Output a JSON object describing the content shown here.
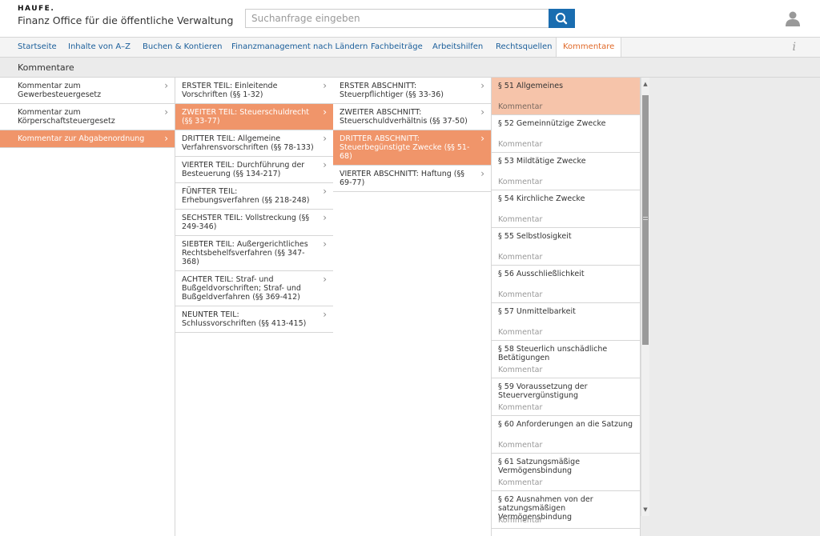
{
  "header": {
    "logo": "HAUFE.",
    "app_title": "Finanz Office für die öffentliche Verwaltung",
    "search_placeholder": "Suchanfrage eingeben"
  },
  "nav": {
    "items": [
      "Startseite",
      "Inhalte von A–Z",
      "Buchen & Kontieren",
      "Finanzmanagement nach Ländern",
      "Fachbeiträge",
      "Arbeitshilfen",
      "Rechtsquellen",
      "Kommentare"
    ],
    "active_index": 7,
    "info": "i"
  },
  "page_title": "Kommentare",
  "col1": [
    {
      "label": "Kommentar zum Gewerbesteuergesetz",
      "active": false
    },
    {
      "label": "Kommentar zum Körperschaftsteuergesetz",
      "active": false
    },
    {
      "label": "Kommentar zur Abgabenordnung",
      "active": true
    }
  ],
  "col2": [
    {
      "label": "ERSTER TEIL: Einleitende Vorschriften (§§ 1-32)",
      "active": false
    },
    {
      "label": "ZWEITER TEIL: Steuerschuldrecht (§§ 33-77)",
      "active": true
    },
    {
      "label": "DRITTER TEIL: Allgemeine Verfahrensvorschriften (§§ 78-133)",
      "active": false
    },
    {
      "label": "VIERTER TEIL: Durchführung der Besteuerung (§§ 134-217)",
      "active": false
    },
    {
      "label": "FÜNFTER TEIL: Erhebungsverfahren (§§ 218-248)",
      "active": false
    },
    {
      "label": "SECHSTER TEIL: Vollstreckung (§§ 249-346)",
      "active": false
    },
    {
      "label": "SIEBTER TEIL: Außergerichtliches Rechtsbehelfsverfahren (§§ 347-368)",
      "active": false
    },
    {
      "label": "ACHTER TEIL: Straf- und Bußgeldvorschriften; Straf- und Bußgeldverfahren (§§ 369-412)",
      "active": false
    },
    {
      "label": "NEUNTER TEIL: Schlussvorschriften (§§ 413-415)",
      "active": false
    }
  ],
  "col3": [
    {
      "label": "ERSTER ABSCHNITT: Steuerpflichtiger (§§ 33-36)",
      "active": false
    },
    {
      "label": "ZWEITER ABSCHNITT: Steuerschuldverhältnis (§§ 37-50)",
      "active": false
    },
    {
      "label": "DRITTER ABSCHNITT: Steuerbegünstigte Zwecke (§§ 51-68)",
      "active": true
    },
    {
      "label": "VIERTER ABSCHNITT: Haftung (§§ 69-77)",
      "active": false
    }
  ],
  "col4": [
    {
      "title": "§ 51 Allgemeines",
      "sub": "Kommentar",
      "active": true
    },
    {
      "title": "§ 52 Gemeinnützige Zwecke",
      "sub": "Kommentar",
      "active": false
    },
    {
      "title": "§ 53 Mildtätige Zwecke",
      "sub": "Kommentar",
      "active": false
    },
    {
      "title": "§ 54 Kirchliche Zwecke",
      "sub": "Kommentar",
      "active": false
    },
    {
      "title": "§ 55 Selbstlosigkeit",
      "sub": "Kommentar",
      "active": false
    },
    {
      "title": "§ 56 Ausschließlichkeit",
      "sub": "Kommentar",
      "active": false
    },
    {
      "title": "§ 57 Unmittelbarkeit",
      "sub": "Kommentar",
      "active": false
    },
    {
      "title": "§ 58 Steuerlich unschädliche Betätigungen",
      "sub": "Kommentar",
      "active": false
    },
    {
      "title": "§ 59 Voraussetzung der Steuervergünstigung",
      "sub": "Kommentar",
      "active": false
    },
    {
      "title": "§ 60 Anforderungen an die Satzung",
      "sub": "Kommentar",
      "active": false
    },
    {
      "title": "§ 61 Satzungsmäßige Vermögensbindung",
      "sub": "Kommentar",
      "active": false
    },
    {
      "title": "§ 62 Ausnahmen von der satzungsmäßigen Vermögensbindung",
      "sub": "Kommentar",
      "active": false
    }
  ],
  "icons": {
    "chevron": "chevron-right-icon",
    "search": "search-icon",
    "user": "user-icon"
  },
  "colors": {
    "brand": "#1a6db0",
    "active_orange": "#f0956a",
    "active_light": "#f6c4aa",
    "nav_active": "#e06a2a"
  }
}
